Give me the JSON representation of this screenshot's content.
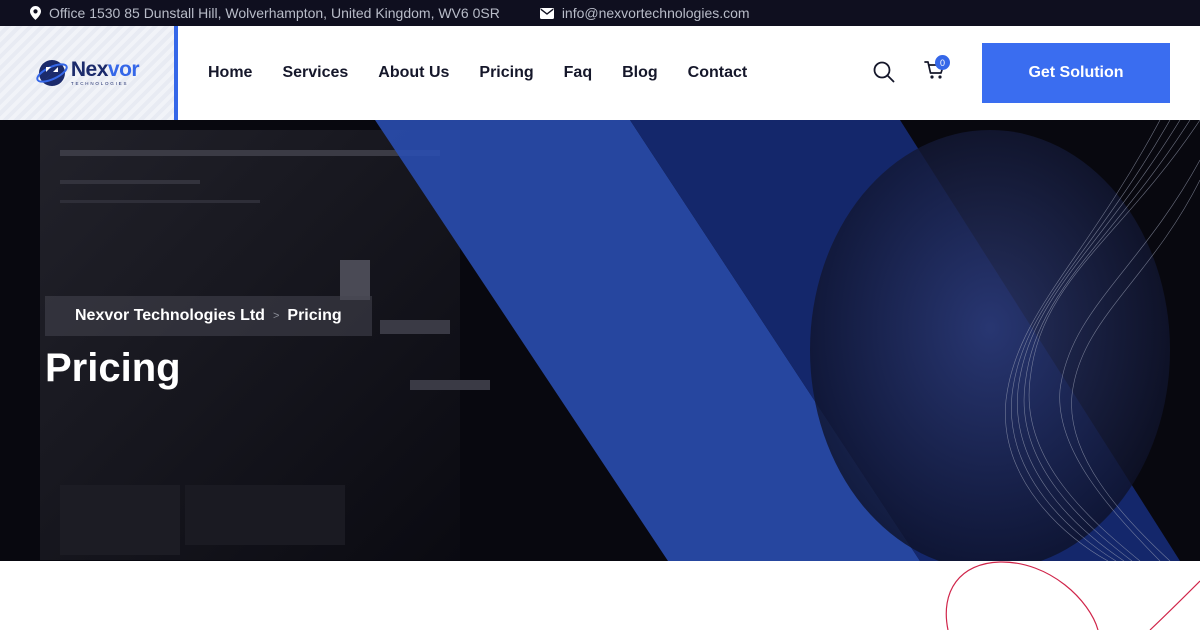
{
  "topbar": {
    "address": "Office 1530 85 Dunstall Hill, Wolverhampton, United Kingdom, WV6 0SR",
    "email": "info@nexvortechnologies.com"
  },
  "logo": {
    "word_main": "Nex",
    "word_accent": "vor",
    "subtitle": "TECHNOLOGIES"
  },
  "nav": {
    "items": [
      {
        "label": "Home"
      },
      {
        "label": "Services"
      },
      {
        "label": "About Us"
      },
      {
        "label": "Pricing"
      },
      {
        "label": "Faq"
      },
      {
        "label": "Blog"
      },
      {
        "label": "Contact"
      }
    ]
  },
  "header": {
    "cart_count": "0",
    "cta_label": "Get Solution"
  },
  "hero": {
    "breadcrumb": {
      "home": "Nexvor Technologies Ltd",
      "separator": ">",
      "current": "Pricing"
    },
    "title": "Pricing"
  },
  "colors": {
    "accent": "#3a6df0",
    "topbar": "#0f0f1f",
    "text_dark": "#15172a"
  }
}
